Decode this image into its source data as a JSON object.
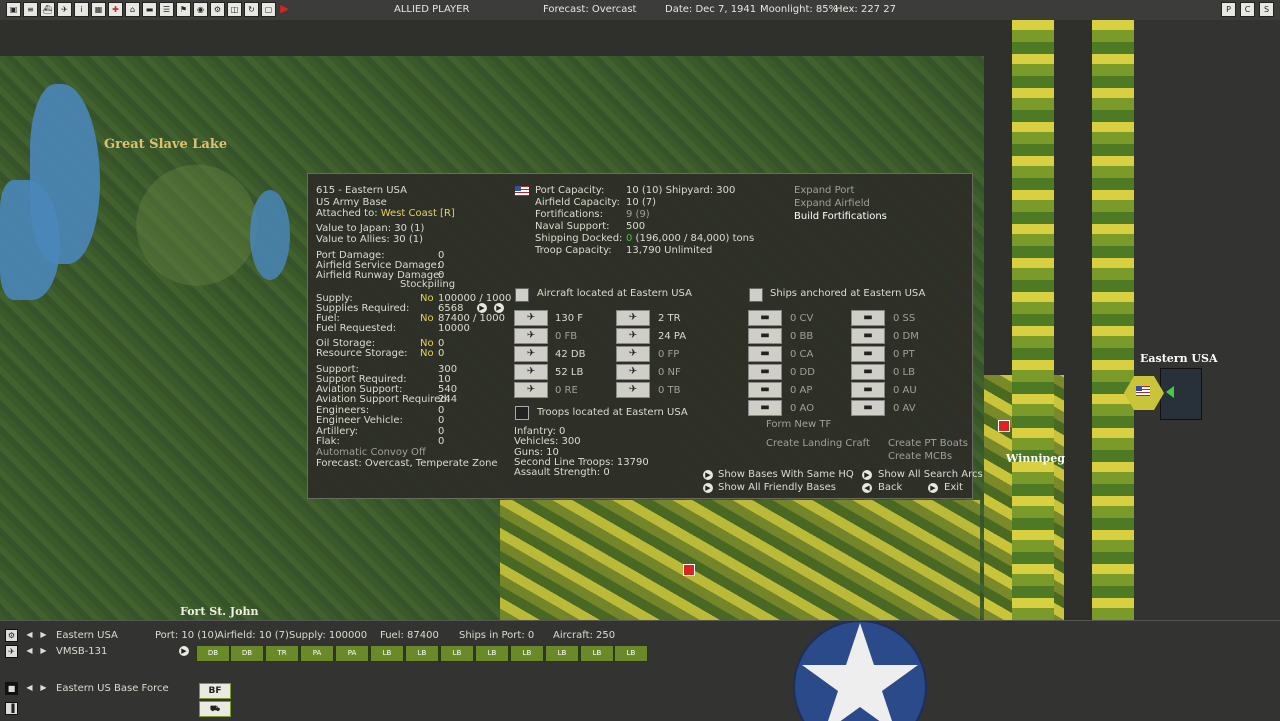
{
  "topbar": {
    "toolbar_icons": [
      "report-icon",
      "list-icon",
      "ships-icon",
      "airgroups-icon",
      "intel-icon",
      "map-icon",
      "target-icon",
      "bases-icon",
      "ships2-icon",
      "ledger-icon",
      "flag-icon",
      "globe-icon",
      "settings-icon",
      "view-icon",
      "cycle-icon",
      "turn-icon"
    ],
    "player": "ALLIED PLAYER",
    "forecast": "Forecast: Overcast",
    "date": "Date: Dec 7, 1941",
    "moonlight": "Moonlight: 85%",
    "hex": "Hex: 227 27",
    "win_buttons": [
      "P",
      "C",
      "S"
    ]
  },
  "map": {
    "labels": {
      "great_slave_lake": "Great Slave Lake",
      "fort_st_john": "Fort St. John",
      "winnipeg": "Winnipeg",
      "eastern_usa": "Eastern USA"
    }
  },
  "panel": {
    "base_header": "615 - Eastern USA",
    "base_type": "US Army Base",
    "attached_label": "Attached to:",
    "attached_value": "West Coast [R]",
    "value_japan": "Value to Japan: 30 (1)",
    "value_allies": "Value to Allies: 30 (1)",
    "damage": [
      {
        "label": "Port Damage:",
        "value": "0"
      },
      {
        "label": "Airfield Service Damage:",
        "value": "0"
      },
      {
        "label": "Airfield Runway Damage:",
        "value": "0"
      }
    ],
    "stockpiling": "Stockpiling",
    "supply": {
      "label": "Supply:",
      "flag": "No",
      "value": "100000 / 1000"
    },
    "supplies_required": {
      "label": "Supplies Required:",
      "value": "6568"
    },
    "fuel": {
      "label": "Fuel:",
      "flag": "No",
      "value": "87400 / 1000"
    },
    "fuel_requested": {
      "label": "Fuel Requested:",
      "value": "10000"
    },
    "oil_storage": {
      "label": "Oil Storage:",
      "flag": "No",
      "value": "0"
    },
    "resource_storage": {
      "label": "Resource Storage:",
      "flag": "No",
      "value": "0"
    },
    "support": [
      {
        "label": "Support:",
        "value": "300"
      },
      {
        "label": "Support Required:",
        "value": "10"
      },
      {
        "label": "Aviation Support:",
        "value": "540"
      },
      {
        "label": "Aviation Support Required:",
        "value": "244"
      },
      {
        "label": "Engineers:",
        "value": "0"
      },
      {
        "label": "Engineer Vehicle:",
        "value": "0"
      },
      {
        "label": "Artillery:",
        "value": "0"
      },
      {
        "label": "Flak:",
        "value": "0"
      }
    ],
    "auto_convoy": "Automatic Convoy Off",
    "forecast": "Forecast: Overcast, Temperate Zone",
    "capacity": [
      {
        "label": "Port Capacity:",
        "value": "10 (10)   Shipyard: 300"
      },
      {
        "label": "Airfield Capacity:",
        "value": "10 (7)"
      },
      {
        "label": "Fortifications:",
        "value": "9 (9)"
      },
      {
        "label": "Naval Support:",
        "value": "500"
      },
      {
        "label": "Shipping Docked:",
        "value_green": "0",
        "value": " (196,000 / 84,000) tons"
      },
      {
        "label": "Troop Capacity:",
        "value": "13,790    Unlimited"
      }
    ],
    "actions": [
      "Expand Port",
      "Expand Airfield",
      "Build Fortifications"
    ],
    "aircraft_header": "Aircraft located at Eastern USA",
    "aircraft_left": [
      "130 F",
      "0 FB",
      "42 DB",
      "52 LB",
      "0 RE"
    ],
    "aircraft_right": [
      "2 TR",
      "24 PA",
      "0 FP",
      "0 NF",
      "0 TB"
    ],
    "ships_header": "Ships anchored at Eastern USA",
    "ships_left": [
      "0 CV",
      "0 BB",
      "0 CA",
      "0 DD",
      "0 AP",
      "0 AO"
    ],
    "ships_right": [
      "0 SS",
      "0 DM",
      "0 PT",
      "0 LB",
      "0 AU",
      "0 AV"
    ],
    "form_new_tf": "Form New TF",
    "create_landing_craft": "Create Landing Craft",
    "create_pt_boats": "Create PT Boats",
    "create_mcbs": "Create MCBs",
    "troops_header": "Troops located at Eastern USA",
    "troops": [
      "Infantry: 0",
      "Vehicles: 300",
      "Guns: 10",
      "Second Line Troops: 13790",
      "Assault Strength: 0"
    ],
    "show_same_hq": "Show Bases With Same HQ",
    "show_friendly": "Show All Friendly Bases",
    "show_search_arcs": "Show All Search Arcs",
    "back": "Back",
    "exit": "Exit"
  },
  "bottom": {
    "base_name": "Eastern USA",
    "port": "Port: 10 (10)",
    "airfield": "Airfield: 10 (7)",
    "supply": "Supply: 100000",
    "fuel": "Fuel: 87400",
    "ships_in_port": "Ships in Port: 0",
    "aircraft": "Aircraft: 250",
    "unit_name": "VMSB-131",
    "air_groups": [
      "DB",
      "DB",
      "TR",
      "PA",
      "PA",
      "LB",
      "LB",
      "LB",
      "LB",
      "LB",
      "LB",
      "LB",
      "LB"
    ],
    "base_force": "Eastern US Base Force",
    "bf_label": "BF"
  },
  "colors": {
    "accent_yellow": "#e6d060",
    "green": "#40c040",
    "panel_bg": "#2d2d28"
  }
}
